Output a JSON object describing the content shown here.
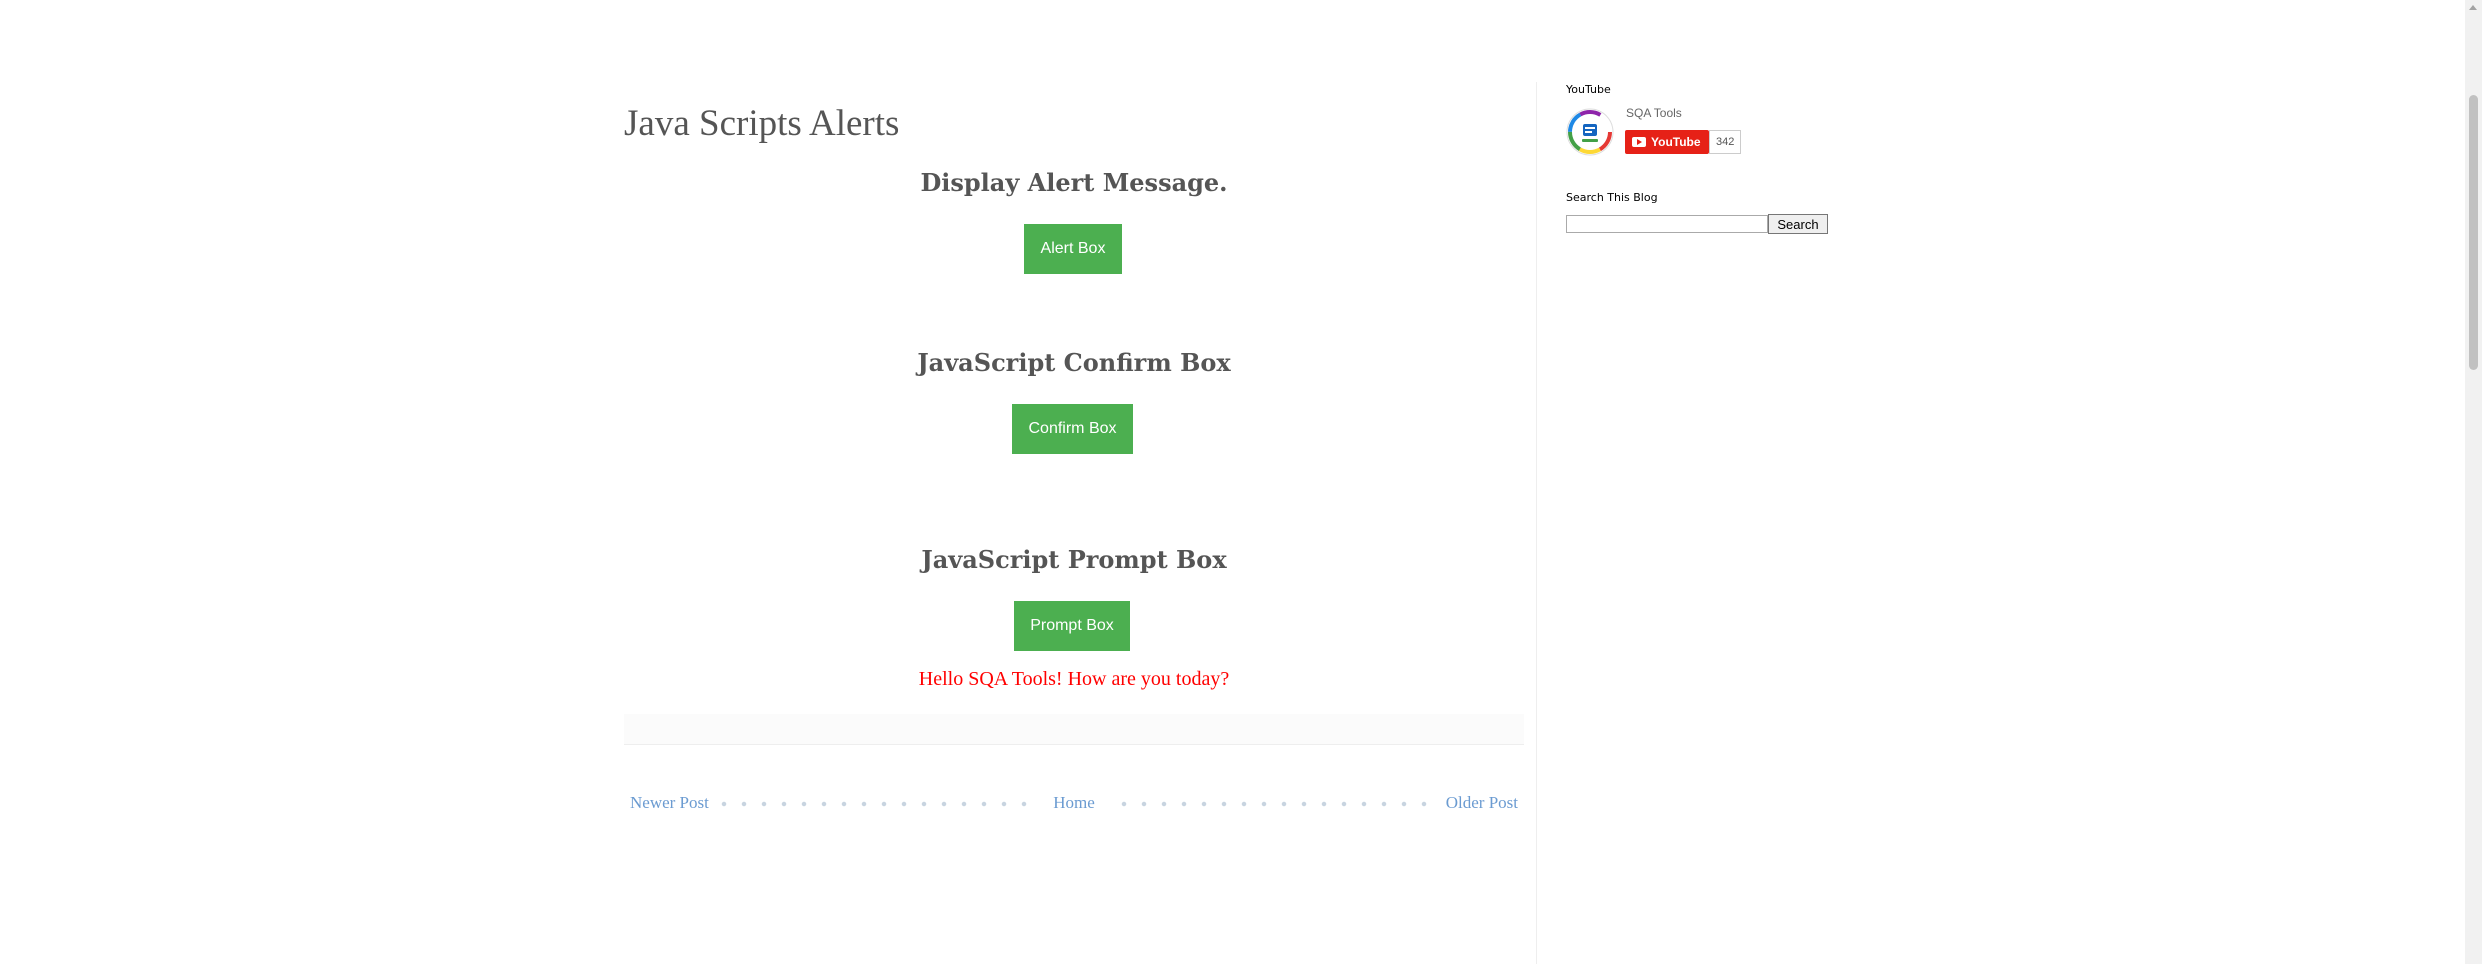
{
  "post": {
    "title": "Java Scripts Alerts",
    "sections": [
      {
        "heading": "Display Alert Message.",
        "button_label": "Alert Box"
      },
      {
        "heading": "JavaScript Confirm Box",
        "button_label": "Confirm Box"
      },
      {
        "heading": "JavaScript Prompt Box",
        "button_label": "Prompt Box"
      }
    ],
    "prompt_result": "Hello SQA Tools! How are you today?"
  },
  "pager": {
    "newer": "Newer Post",
    "home": "Home",
    "older": "Older Post"
  },
  "sidebar": {
    "youtube": {
      "title": "YouTube",
      "channel_name": "SQA Tools",
      "button_label": "YouTube",
      "subscriber_count": "342"
    },
    "search": {
      "title": "Search This Blog",
      "placeholder": "",
      "button_label": "Search"
    }
  },
  "colors": {
    "button_green": "#4caf50",
    "result_red": "#ff0000",
    "link_blue": "#6b9bd1",
    "youtube_red": "#e62117"
  }
}
